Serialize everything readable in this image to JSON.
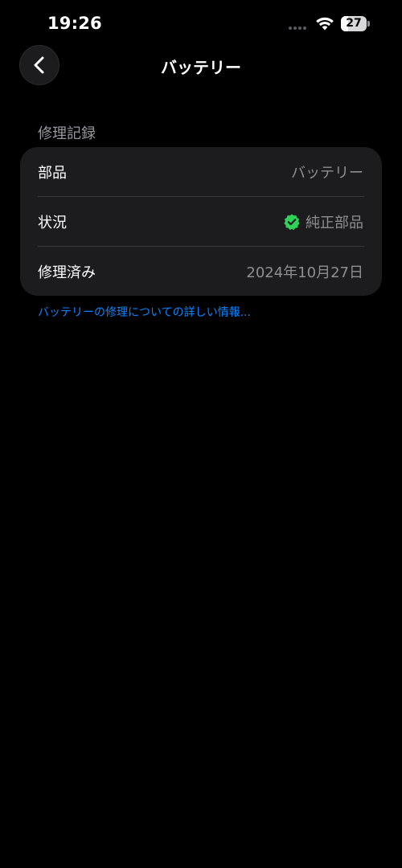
{
  "status_bar": {
    "time": "19:26",
    "battery_level": "27",
    "battery_fraction": 0.27
  },
  "nav": {
    "title": "バッテリー",
    "back_icon": "chevron-left-icon"
  },
  "repair_record": {
    "section_title": "修理記録",
    "rows": [
      {
        "label": "部品",
        "value": "バッテリー"
      },
      {
        "label": "状況",
        "value": "純正部品",
        "icon": "verified-check-icon"
      },
      {
        "label": "修理済み",
        "value": "2024年10月27日"
      }
    ]
  },
  "info_link": "バッテリーの修理についての詳しい情報...",
  "colors": {
    "background": "#000000",
    "card": "#1c1c1e",
    "secondary_text": "#8e8e93",
    "link": "#0a84ff",
    "verified": "#30d158"
  }
}
